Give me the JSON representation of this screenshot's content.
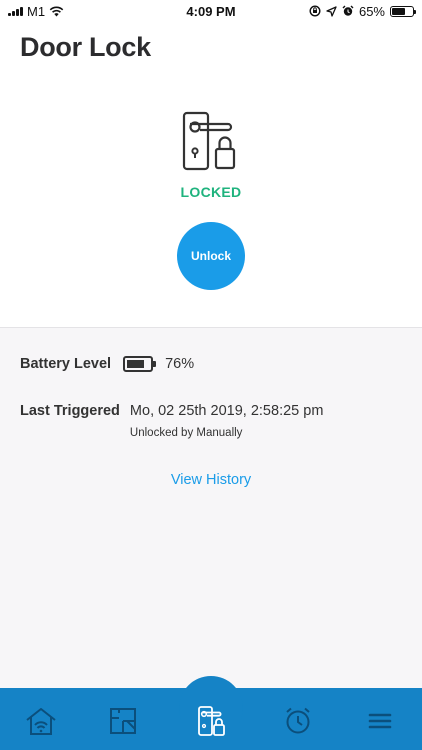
{
  "status_bar": {
    "carrier": "M1",
    "time": "4:09 PM",
    "battery_percent": "65%",
    "battery_fraction": 0.65,
    "icons": [
      "signal-icon",
      "wifi-icon",
      "screen-rotation-lock-icon",
      "location-icon",
      "alarm-icon",
      "battery-icon"
    ]
  },
  "header": {
    "title": "Door Lock"
  },
  "lock": {
    "icon": "door-handle-lock-icon",
    "status": "LOCKED",
    "status_color": "#1fb37e",
    "action_label": "Unlock",
    "action_color": "#1a9ce8"
  },
  "details": {
    "battery_label": "Battery Level",
    "battery_value": "76%",
    "battery_fraction": 0.76,
    "last_triggered_label": "Last Triggered",
    "last_triggered_time": "Mo, 02 25th 2019, 2:58:25 pm",
    "last_triggered_detail": "Unlocked by Manually"
  },
  "history_link": "View History",
  "bottom_nav": {
    "color": "#1583c6",
    "items": [
      {
        "icon": "home-wifi-icon",
        "active": false
      },
      {
        "icon": "floor-plan-icon",
        "active": false
      },
      {
        "icon": "door-lock-icon",
        "active": true
      },
      {
        "icon": "alarm-clock-icon",
        "active": false
      },
      {
        "icon": "menu-icon",
        "active": false
      }
    ]
  }
}
